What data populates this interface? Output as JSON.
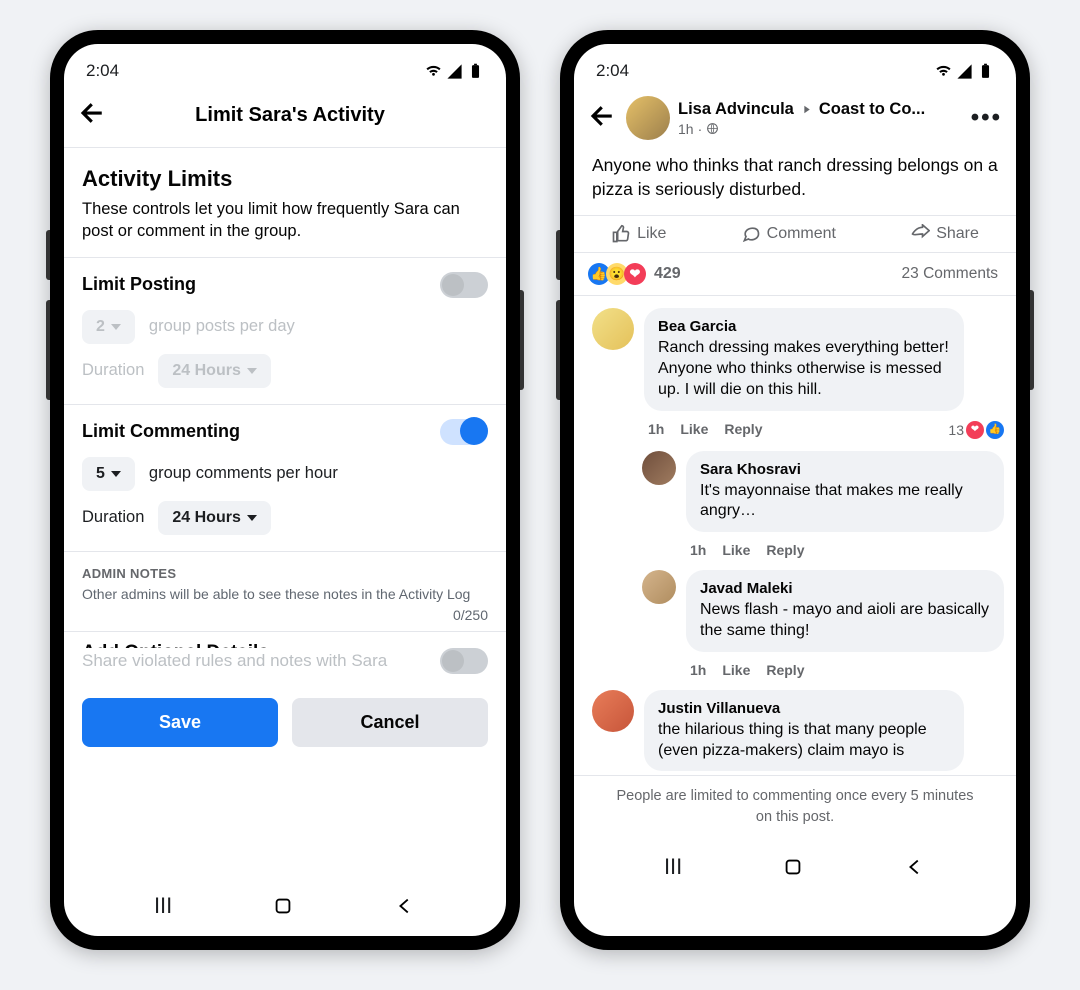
{
  "phone1": {
    "status_time": "2:04",
    "title": "Limit Sara's Activity",
    "h2": "Activity Limits",
    "desc": "These controls let you limit how frequently Sara can post or comment in the group.",
    "limit_posting": {
      "label": "Limit Posting",
      "count": "2",
      "suffix": "group posts per day",
      "duration_label": "Duration",
      "duration_value": "24 Hours"
    },
    "limit_commenting": {
      "label": "Limit Commenting",
      "count": "5",
      "suffix": "group comments per hour",
      "duration_label": "Duration",
      "duration_value": "24 Hours"
    },
    "admin_notes_label": "ADMIN NOTES",
    "admin_notes_desc": "Other admins will be able to see these notes in the Activity Log",
    "counter": "0/250",
    "extra_title": "Add Optional Details",
    "extra_text": "Share violated rules and notes with Sara",
    "save": "Save",
    "cancel": "Cancel"
  },
  "phone2": {
    "status_time": "2:04",
    "author": "Lisa Advincula",
    "group": "Coast to Co...",
    "time": "1h",
    "post_body": "Anyone who thinks that ranch dressing belongs on a pizza is seriously disturbed.",
    "actions": {
      "like": "Like",
      "comment": "Comment",
      "share": "Share"
    },
    "react_count": "429",
    "comment_count": "23 Comments",
    "comments": [
      {
        "name": "Bea Garcia",
        "text": "Ranch dressing makes everything better! Anyone who thinks otherwise is messed up. I will die on this hill.",
        "time": "1h",
        "like": "Like",
        "reply": "Reply",
        "r_count": "13"
      },
      {
        "name": "Sara Khosravi",
        "text": "It's mayonnaise that makes me really angry…",
        "time": "1h",
        "like": "Like",
        "reply": "Reply"
      },
      {
        "name": "Javad Maleki",
        "text": "News flash - mayo and aioli are basically the same thing!",
        "time": "1h",
        "like": "Like",
        "reply": "Reply"
      },
      {
        "name": "Justin Villanueva",
        "text": "the hilarious thing is that many people (even pizza-makers) claim mayo is"
      }
    ],
    "footer": "People are limited to commenting once every 5 minutes on this post."
  }
}
